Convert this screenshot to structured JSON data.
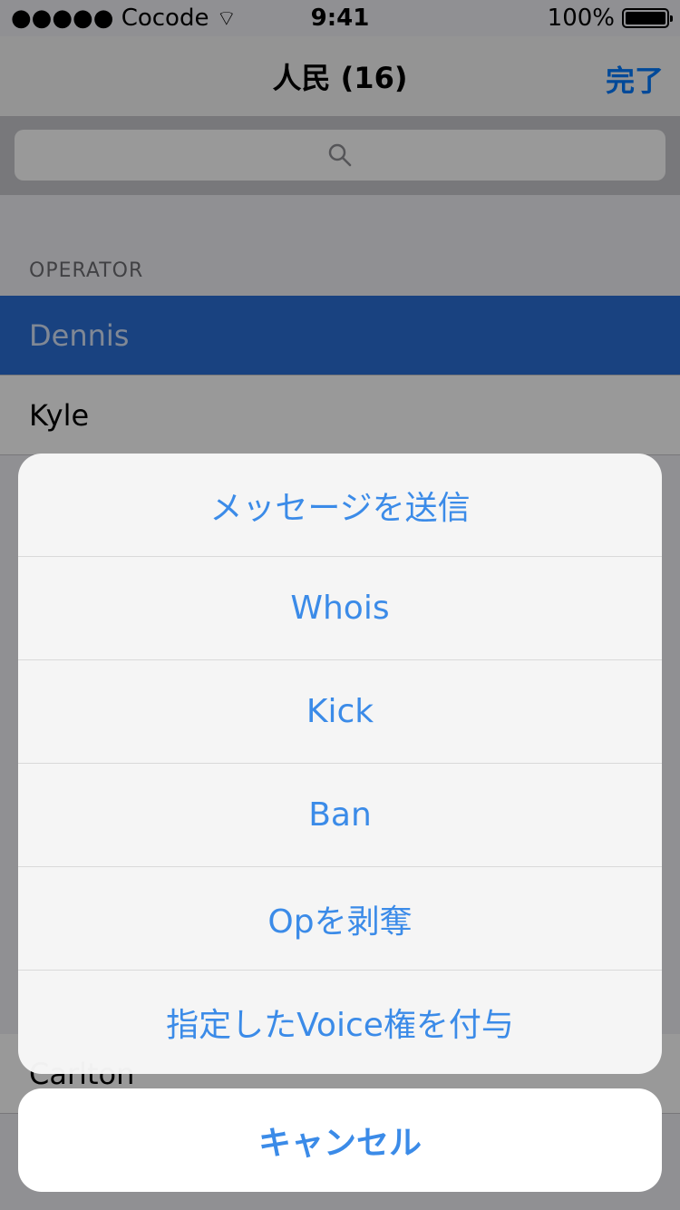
{
  "status_bar": {
    "carrier": "●●●●● Cocode",
    "time": "9:41",
    "battery": "100%"
  },
  "nav": {
    "title": "人民 (16)",
    "done_label": "完了"
  },
  "search": {
    "placeholder": ""
  },
  "list": {
    "section_header": "OPERATOR",
    "rows": [
      "Dennis",
      "Kyle",
      "Carlton"
    ]
  },
  "action_sheet": {
    "actions": [
      "メッセージを送信",
      "Whois",
      "Kick",
      "Ban",
      "Opを剥奪",
      "指定したVoice権を付与"
    ],
    "cancel_label": "キャンセル"
  },
  "colors": {
    "accent": "#3b8be8",
    "selected_row": "#2a6ed6"
  }
}
